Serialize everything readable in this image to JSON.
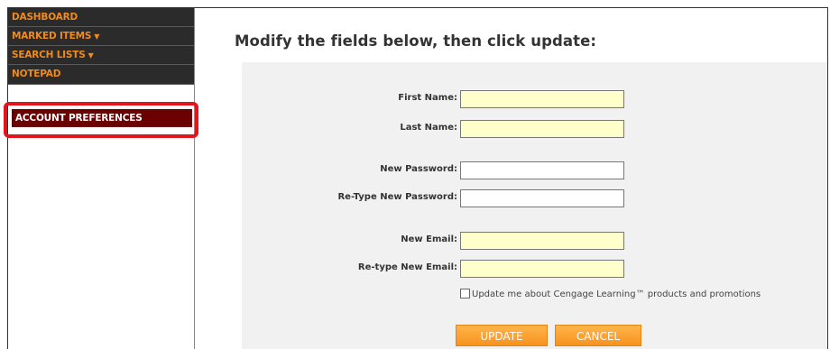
{
  "sidebar": {
    "items": [
      {
        "label": "DASHBOARD",
        "arrow": ""
      },
      {
        "label": "MARKED ITEMS",
        "arrow": "▼"
      },
      {
        "label": "SEARCH LISTS",
        "arrow": "▼"
      },
      {
        "label": "NOTEPAD",
        "arrow": ""
      },
      {
        "label": "ACCOUNT PREFERENCES",
        "arrow": ""
      }
    ]
  },
  "main": {
    "title": "Modify the fields below, then click update:",
    "form": {
      "first_name_label": "First Name:",
      "last_name_label": "Last Name:",
      "new_password_label": "New Password:",
      "retype_password_label": "Re-Type New Password:",
      "new_email_label": "New Email:",
      "retype_email_label": "Re-type New Email:",
      "checkbox_label": "Update me about Cengage Learning™ products and promotions",
      "update_label": "UPDATE",
      "cancel_label": "CANCEL"
    }
  },
  "colors": {
    "highlight": "#e2141c",
    "nav_text": "#f08a1c",
    "nav_active_bg": "#6b0000",
    "button": "#f7931e",
    "input_fill": "#ffffcc"
  }
}
